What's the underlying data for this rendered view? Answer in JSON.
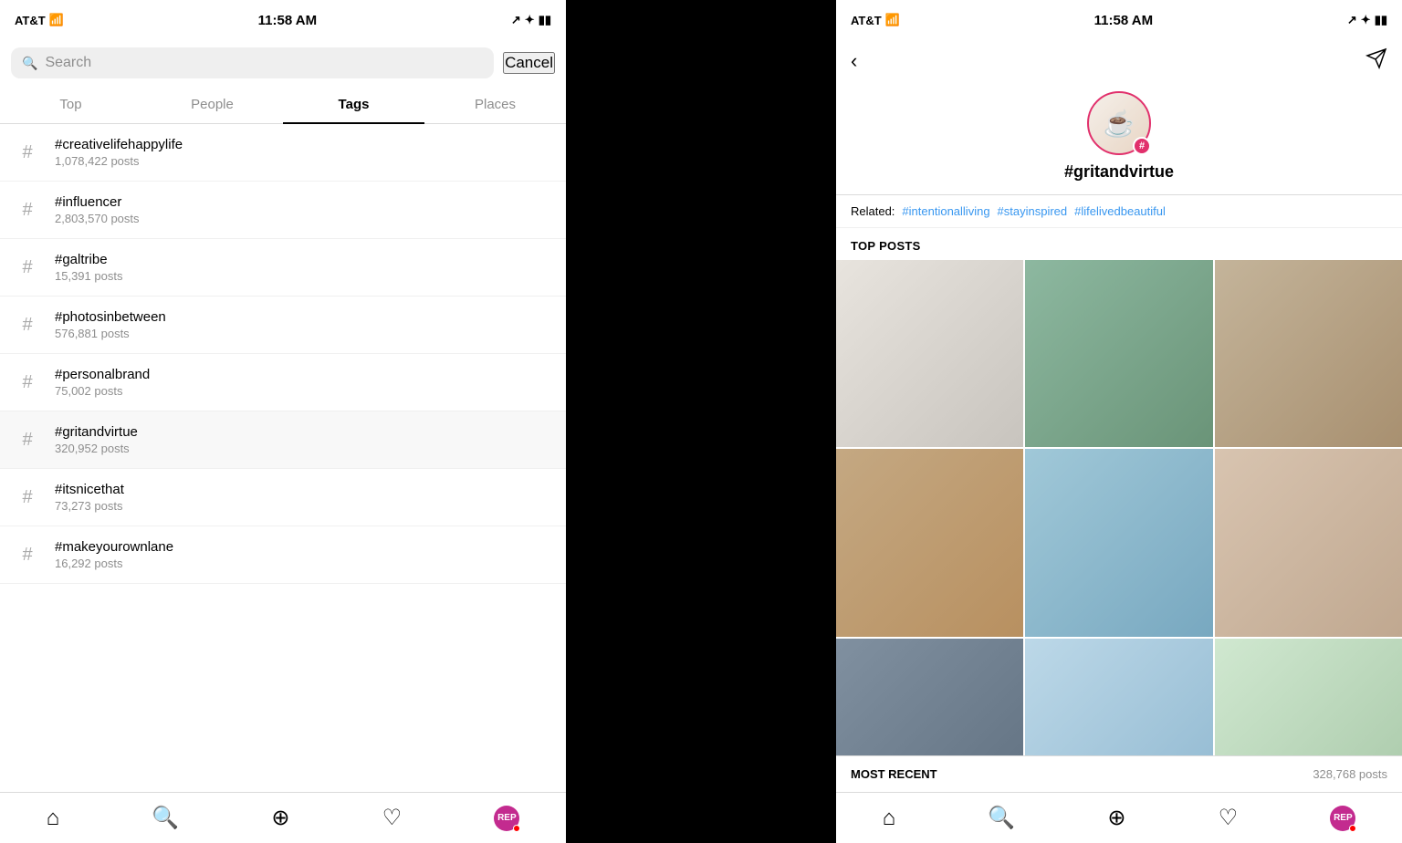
{
  "left_phone": {
    "status": {
      "carrier": "AT&T",
      "time": "11:58 AM",
      "signal": "●●●●",
      "wifi": "wifi",
      "battery": "battery"
    },
    "search": {
      "placeholder": "Search",
      "cancel_label": "Cancel"
    },
    "tabs": [
      {
        "id": "top",
        "label": "Top",
        "active": false
      },
      {
        "id": "people",
        "label": "People",
        "active": false
      },
      {
        "id": "tags",
        "label": "Tags",
        "active": true
      },
      {
        "id": "places",
        "label": "Places",
        "active": false
      }
    ],
    "tags": [
      {
        "name": "#creativelifehappylife",
        "count": "1,078,422 posts"
      },
      {
        "name": "#influencer",
        "count": "2,803,570 posts"
      },
      {
        "name": "#galtribe",
        "count": "15,391 posts"
      },
      {
        "name": "#photosinbetween",
        "count": "576,881 posts"
      },
      {
        "name": "#personalbrand",
        "count": "75,002 posts"
      },
      {
        "name": "#gritandvirtue",
        "count": "320,952 posts"
      },
      {
        "name": "#itsnicethat",
        "count": "73,273 posts"
      },
      {
        "name": "#makeyourownlane",
        "count": "16,292 posts"
      }
    ],
    "bottom_nav": {
      "home": "⌂",
      "search": "🔍",
      "add": "⊕",
      "heart": "♡",
      "profile": "REP"
    }
  },
  "right_phone": {
    "status": {
      "carrier": "AT&T",
      "time": "11:58 AM"
    },
    "hashtag_title": "#gritandvirtue",
    "related_label": "Related:",
    "related_tags": [
      "#intentionalliving",
      "#stayinspired",
      "#lifelivedbeautiful"
    ],
    "top_posts_label": "TOP POSTS",
    "most_recent_label": "MOST RECENT",
    "most_recent_count": "328,768 posts",
    "bottom_nav": {
      "home": "⌂",
      "search": "🔍",
      "add": "⊕",
      "heart": "♡",
      "profile": "REP"
    }
  }
}
